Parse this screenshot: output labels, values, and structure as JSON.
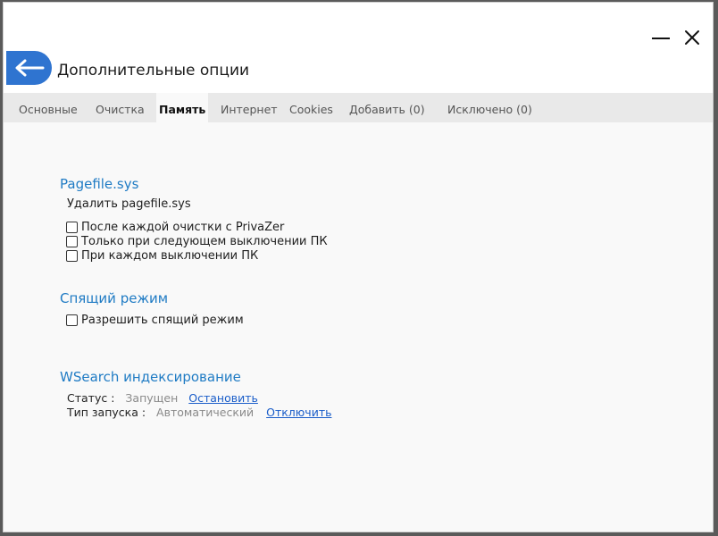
{
  "window": {
    "title": "Дополнительные опции",
    "back_icon": "arrow-left-icon",
    "minimize_icon": "minimize-icon",
    "close_icon": "close-icon"
  },
  "tabs": [
    {
      "label": "Основные",
      "active": false
    },
    {
      "label": "Очистка",
      "active": false
    },
    {
      "label": "Память",
      "active": true
    },
    {
      "label": "Интернет",
      "active": false
    },
    {
      "label": "Cookies",
      "active": false
    },
    {
      "label": "Добавить (0)",
      "active": false
    },
    {
      "label": "Исключено (0)",
      "active": false
    }
  ],
  "pagefile": {
    "title": "Pagefile.sys",
    "subtitle": "Удалить pagefile.sys",
    "options": [
      {
        "label": "После каждой очистки с PrivaZer",
        "checked": false
      },
      {
        "label": "Только при следующем выключении ПК",
        "checked": false
      },
      {
        "label": "При каждом выключении ПК",
        "checked": false
      }
    ]
  },
  "sleep": {
    "title": "Спящий режим",
    "options": [
      {
        "label": "Разрешить спящий режим",
        "checked": false
      }
    ]
  },
  "wsearch": {
    "title": "WSearch индексирование",
    "status_label": "Статус :",
    "status_value": "Запущен",
    "status_action": "Остановить",
    "startup_label": "Тип запуска :",
    "startup_value": "Автоматический",
    "startup_action": "Отключить"
  },
  "colors": {
    "accent": "#2f74d0",
    "section_title": "#1f7bc4",
    "link": "#1a5dc9",
    "tabbar": "#e9e9e9"
  }
}
